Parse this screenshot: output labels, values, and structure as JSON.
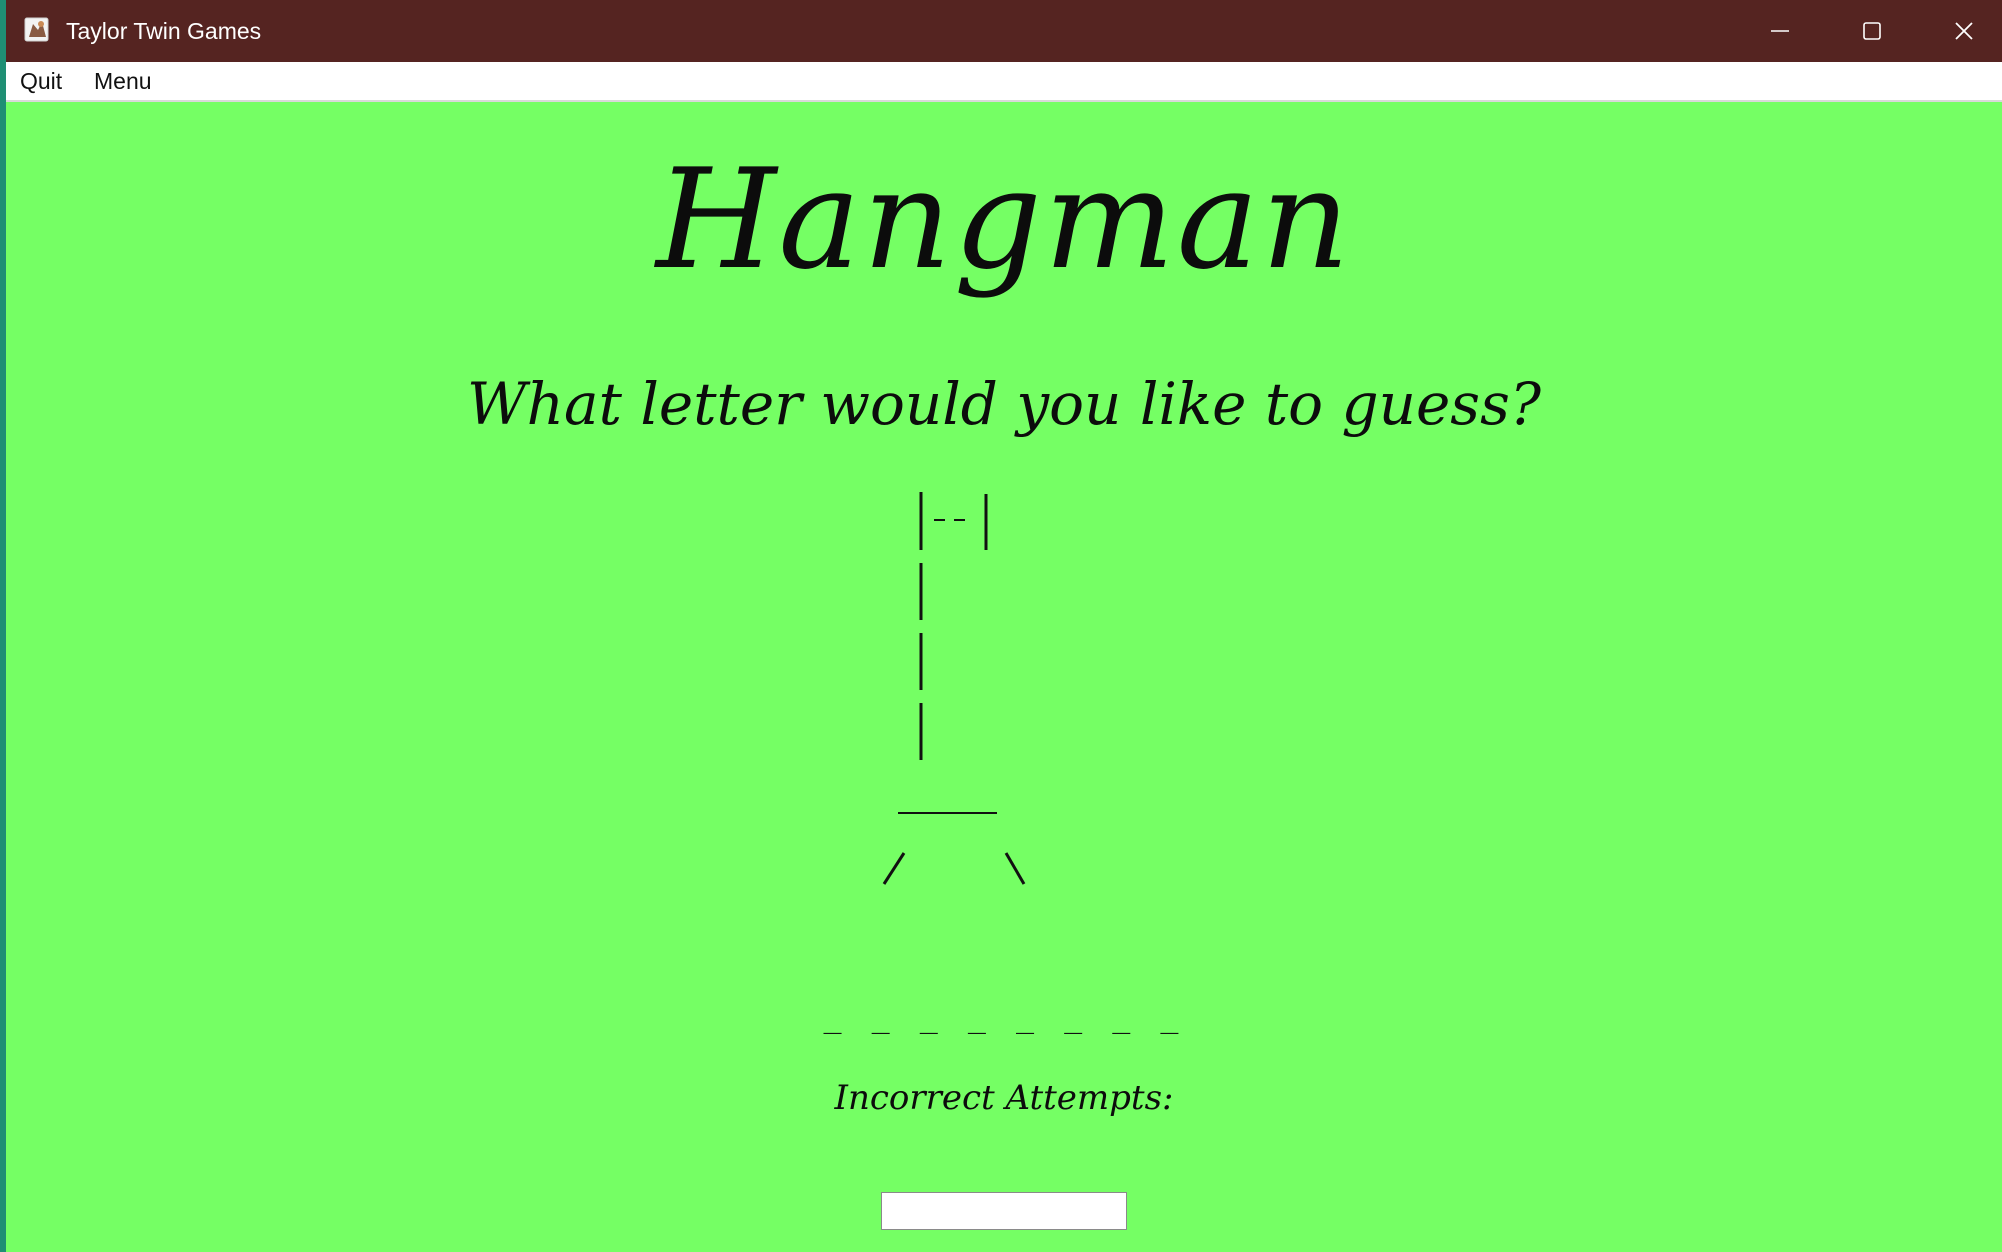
{
  "window": {
    "title": "Taylor Twin Games",
    "icon": "app-icon",
    "controls": [
      "minimize-icon",
      "maximize-icon",
      "close-icon"
    ]
  },
  "menubar": {
    "items": [
      {
        "label": "Quit"
      },
      {
        "label": "Menu"
      }
    ]
  },
  "game": {
    "title": "Hangman",
    "prompt": "What letter would you like to guess?",
    "word_blanks": "_ _ _ _ _ _ _ _",
    "incorrect_label": "Incorrect Attempts:",
    "guess_input_value": ""
  },
  "colors": {
    "title_bar": "#552421",
    "background": "#75ff64",
    "menu_bar": "#ffffff",
    "text": "#0c0c0c"
  }
}
